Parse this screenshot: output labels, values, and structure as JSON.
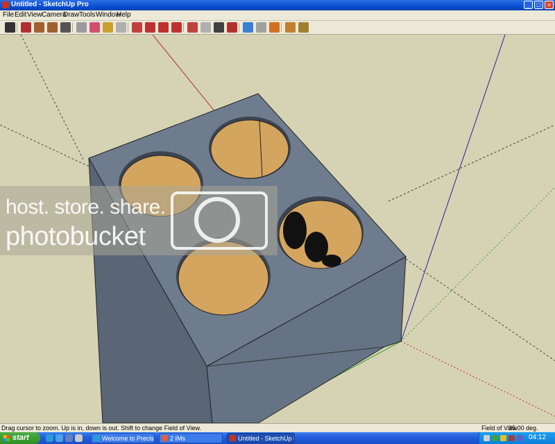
{
  "window": {
    "title": "Untitled - SketchUp Pro",
    "min": "_",
    "max": "□",
    "close": "×"
  },
  "menu": [
    "File",
    "Edit",
    "View",
    "Camera",
    "Draw",
    "Tools",
    "Window",
    "Help"
  ],
  "toolbar": {
    "tools": [
      {
        "name": "select",
        "color": "#333333"
      },
      {
        "name": "pencil",
        "color": "#b03030"
      },
      {
        "name": "rectangle",
        "color": "#a06030"
      },
      {
        "name": "circle",
        "color": "#a06030"
      },
      {
        "name": "arc",
        "color": "#555555"
      },
      {
        "name": "make-component",
        "color": "#9a9aa0"
      },
      {
        "name": "eraser",
        "color": "#d05070"
      },
      {
        "name": "tape-measure",
        "color": "#c8a030"
      },
      {
        "name": "paint-bucket",
        "color": "#b0b0b0"
      },
      {
        "name": "push-pull",
        "color": "#c04040"
      },
      {
        "name": "move",
        "color": "#c03030"
      },
      {
        "name": "rotate",
        "color": "#c03030"
      },
      {
        "name": "offset",
        "color": "#c03030"
      },
      {
        "name": "orbit",
        "color": "#c04040"
      },
      {
        "name": "pan",
        "color": "#b0b0b0"
      },
      {
        "name": "zoom",
        "color": "#404040"
      },
      {
        "name": "zoom-extents",
        "color": "#b03030"
      },
      {
        "name": "get-models",
        "color": "#3a7fd0"
      },
      {
        "name": "share-model",
        "color": "#a0a0a0"
      },
      {
        "name": "google-earth",
        "color": "#d07020"
      },
      {
        "name": "get-current-view",
        "color": "#c08030"
      },
      {
        "name": "toggle-terrain",
        "color": "#a08030"
      }
    ]
  },
  "watermark": {
    "line1": "host. store. share.",
    "line2": "photobucket"
  },
  "status": {
    "hint": "Drag cursor to zoom.  Up is in, down is out.  Shift to change Field of View.",
    "vcb_label": "Field of View",
    "vcb_value": "35.00 deg."
  },
  "taskbar": {
    "start": "start",
    "tasks": [
      {
        "label": "Welcome to Precision ...",
        "active": false
      },
      {
        "label": "2 IMs",
        "active": false
      },
      {
        "label": "Untitled - SketchUp Pro",
        "active": true
      }
    ],
    "clock": "04:12"
  },
  "colors": {
    "box_top": "#6e7c8e",
    "box_left": "#5a6676",
    "box_right": "#667384",
    "wood": "#d4a55e"
  }
}
